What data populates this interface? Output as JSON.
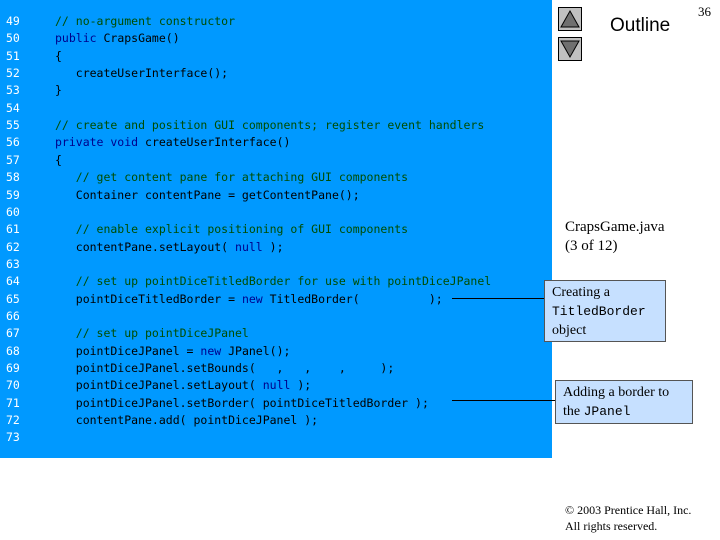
{
  "slide": {
    "page_number": "36",
    "outline_label": "Outline"
  },
  "file_caption": {
    "line1": "CrapsGame.java",
    "line2": "(3 of 12)"
  },
  "code_lines": [
    {
      "num": "49",
      "segments": [
        {
          "cls": "c",
          "text": "// no-argument constructor"
        }
      ]
    },
    {
      "num": "50",
      "segments": [
        {
          "cls": "k",
          "text": "public"
        },
        {
          "cls": "t",
          "text": " CrapsGame()"
        }
      ]
    },
    {
      "num": "51",
      "segments": [
        {
          "cls": "t",
          "text": "{"
        }
      ]
    },
    {
      "num": "52",
      "segments": [
        {
          "cls": "t",
          "text": "   createUserInterface();"
        }
      ]
    },
    {
      "num": "53",
      "segments": [
        {
          "cls": "t",
          "text": "}"
        }
      ]
    },
    {
      "num": "54",
      "segments": []
    },
    {
      "num": "55",
      "segments": [
        {
          "cls": "c",
          "text": "// create and position GUI components; register event handlers"
        }
      ]
    },
    {
      "num": "56",
      "segments": [
        {
          "cls": "k",
          "text": "private void"
        },
        {
          "cls": "t",
          "text": " createUserInterface()"
        }
      ]
    },
    {
      "num": "57",
      "segments": [
        {
          "cls": "t",
          "text": "{"
        }
      ]
    },
    {
      "num": "58",
      "segments": [
        {
          "cls": "c",
          "text": "   // get content pane for attaching GUI components"
        }
      ]
    },
    {
      "num": "59",
      "segments": [
        {
          "cls": "t",
          "text": "   Container contentPane = getContentPane();"
        }
      ]
    },
    {
      "num": "60",
      "segments": []
    },
    {
      "num": "61",
      "segments": [
        {
          "cls": "c",
          "text": "   // enable explicit positioning of GUI components"
        }
      ]
    },
    {
      "num": "62",
      "segments": [
        {
          "cls": "t",
          "text": "   contentPane.setLayout( "
        },
        {
          "cls": "k",
          "text": "null"
        },
        {
          "cls": "t",
          "text": " );"
        }
      ]
    },
    {
      "num": "63",
      "segments": []
    },
    {
      "num": "64",
      "segments": [
        {
          "cls": "c",
          "text": "   // set up pointDiceTitledBorder for use with pointDiceJPanel"
        }
      ]
    },
    {
      "num": "65",
      "segments": [
        {
          "cls": "t",
          "text": "   pointDiceTitledBorder = "
        },
        {
          "cls": "k",
          "text": "new"
        },
        {
          "cls": "t",
          "text": " TitledBorder(          );"
        }
      ]
    },
    {
      "num": "66",
      "segments": []
    },
    {
      "num": "67",
      "segments": [
        {
          "cls": "c",
          "text": "   // set up pointDiceJPanel"
        }
      ]
    },
    {
      "num": "68",
      "segments": [
        {
          "cls": "t",
          "text": "   pointDiceJPanel = "
        },
        {
          "cls": "k",
          "text": "new"
        },
        {
          "cls": "t",
          "text": " JPanel();"
        }
      ]
    },
    {
      "num": "69",
      "segments": [
        {
          "cls": "t",
          "text": "   pointDiceJPanel.setBounds(   ,   ,    ,     );"
        }
      ]
    },
    {
      "num": "70",
      "segments": [
        {
          "cls": "t",
          "text": "   pointDiceJPanel.setLayout( "
        },
        {
          "cls": "k",
          "text": "null"
        },
        {
          "cls": "t",
          "text": " );"
        }
      ]
    },
    {
      "num": "71",
      "segments": [
        {
          "cls": "t",
          "text": "   pointDiceJPanel.setBorder( pointDiceTitledBorder );"
        }
      ]
    },
    {
      "num": "72",
      "segments": [
        {
          "cls": "t",
          "text": "   contentPane.add( pointDiceJPanel );"
        }
      ]
    },
    {
      "num": "73",
      "segments": []
    }
  ],
  "callouts": {
    "titled_border": {
      "line1": "Creating a",
      "mono": "TitledBorder",
      "line3": "object"
    },
    "add_border": {
      "line1": "Adding a border to",
      "prefix": "the ",
      "mono": "JPanel"
    }
  },
  "copyright": {
    "line1": "© 2003 Prentice Hall, Inc.",
    "line2": "All rights reserved."
  }
}
